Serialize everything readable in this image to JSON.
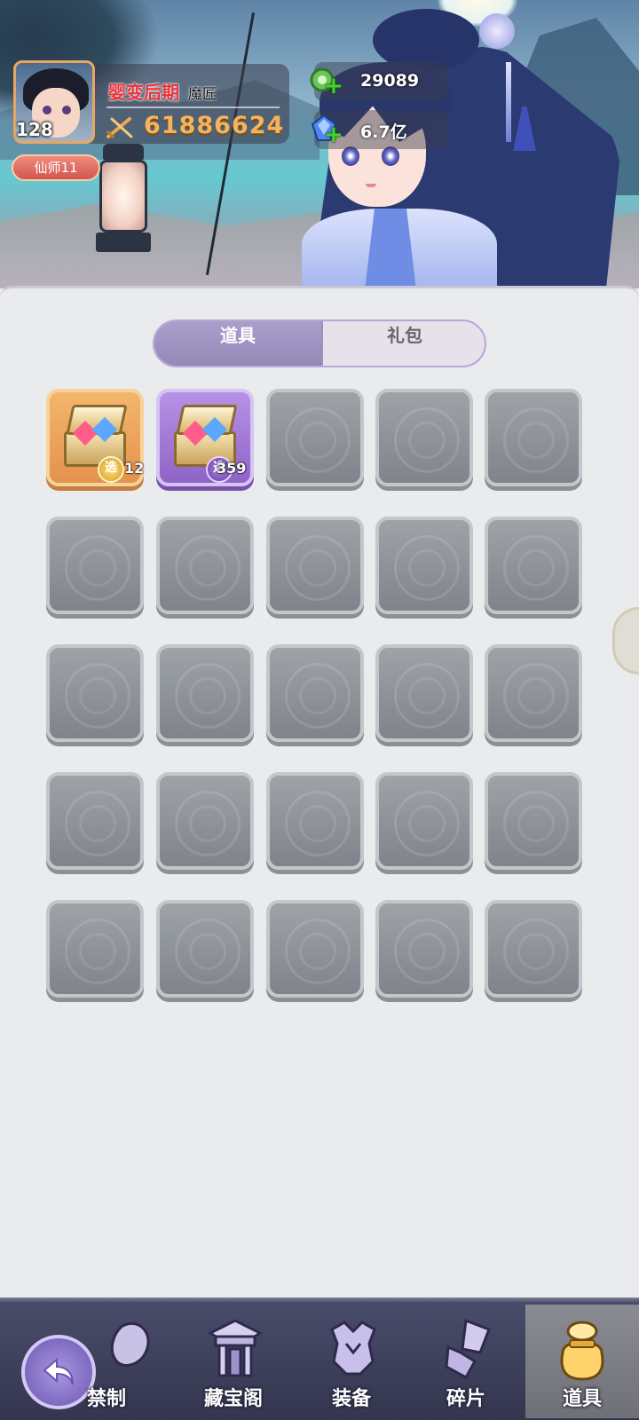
{
  "player": {
    "level": "128",
    "realm": "婴变后期",
    "profession": "魔匠",
    "power": "61886624",
    "title_badge": "仙师11"
  },
  "currencies": [
    {
      "icon": "jade-coin-icon",
      "value": "29089"
    },
    {
      "icon": "blue-crystal-icon",
      "value": "6.7亿"
    }
  ],
  "tabs": [
    {
      "label": "道具",
      "active": true
    },
    {
      "label": "礼包",
      "active": false
    }
  ],
  "inventory": {
    "slots": [
      {
        "item": "treasure-chest",
        "rarity": "orange",
        "badge": "选",
        "count": "12"
      },
      {
        "item": "treasure-chest",
        "rarity": "purple",
        "badge": "选",
        "count": "359"
      }
    ],
    "empty_slot_count": 23,
    "columns": 5,
    "rows": 5
  },
  "bottom_nav": {
    "items": [
      {
        "label": "禁制",
        "icon": "seal-icon",
        "active": false
      },
      {
        "label": "藏宝阁",
        "icon": "pavilion-icon",
        "active": false
      },
      {
        "label": "装备",
        "icon": "armor-icon",
        "active": false
      },
      {
        "label": "碎片",
        "icon": "fragment-icon",
        "active": false
      },
      {
        "label": "道具",
        "icon": "money-bag-icon",
        "active": true
      }
    ]
  },
  "colors": {
    "realm_text": "#e8323a",
    "power_text": "#f5b45c",
    "tab_active": "#9d8fc5",
    "nav_background": "#3c3e58"
  }
}
